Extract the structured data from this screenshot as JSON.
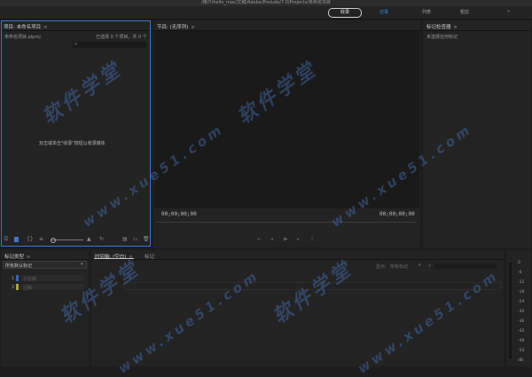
{
  "window": {
    "title": "/用户/hello_mac/文稿/Adobe/Prelude/7.0/Projects/未命名项目"
  },
  "workspace": {
    "ingest": "收录",
    "tabs": [
      {
        "label": "记录",
        "active": true
      },
      {
        "label": "列表",
        "active": false
      },
      {
        "label": "粗剪",
        "active": false
      }
    ],
    "menu": "»"
  },
  "project": {
    "title": "项目: 未命名项目",
    "path": "未命名项目.plproj",
    "selection": "已选择 0 个项目，共 0 个",
    "empty_hint": "双击或单击\"收录\"按钮以收录媒体"
  },
  "monitor": {
    "title": "节目: (无序列)",
    "tc_left": "00;00;00;00",
    "tc_right": "00;00;00;00"
  },
  "inspector": {
    "title": "标记检查器",
    "message": "未选择任何标记"
  },
  "marker_type": {
    "title": "标记类型",
    "dropdown": "所有默认标记",
    "items": [
      {
        "num": "1",
        "label": "子剪辑",
        "color": "#3a64b8"
      },
      {
        "num": "2",
        "label": "注释",
        "color": "#a6a63c"
      }
    ]
  },
  "timeline": {
    "tab_timeline": "时间轴: (空白)",
    "tab_marker": "标记",
    "show_label": "显示:",
    "show_value": "所有标记"
  },
  "meter": {
    "labels": [
      "0",
      "-6",
      "-12",
      "-18",
      "-24",
      "-30",
      "-36",
      "-42",
      "-48",
      "-54",
      "dB"
    ]
  },
  "watermark": {
    "text": "软件学堂",
    "url": "www.xue51.com"
  }
}
